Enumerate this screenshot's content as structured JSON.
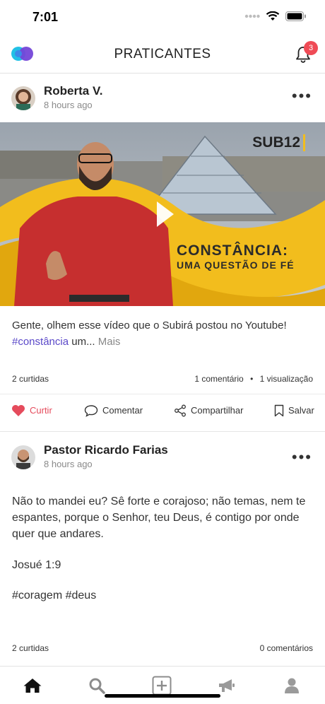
{
  "status": {
    "time": "7:01"
  },
  "header": {
    "title": "PRATICANTES",
    "notification_count": "3"
  },
  "post1": {
    "author": "Roberta V.",
    "time": "8 hours ago",
    "video": {
      "brand": "SUB12",
      "title_line1": "CONSTÂNCIA:",
      "title_line2": "UMA QUESTÃO DE FÉ"
    },
    "caption": "Gente, olhem esse vídeo que o Subirá postou no Youtube!",
    "hashtag": "#constância",
    "caption_rest": " um...",
    "more_label": "Mais",
    "likes": "2 curtidas",
    "comments": "1 comentário",
    "views": "1 visualização",
    "actions": {
      "like": "Curtir",
      "comment": "Comentar",
      "share": "Compartilhar",
      "save": "Salvar"
    }
  },
  "post2": {
    "author": "Pastor Ricardo Farias",
    "time": "8 hours ago",
    "text": "Não to mandei eu? Sê forte e corajoso; não temas, nem te espantes, porque o Senhor, teu Deus, é contigo por onde quer que andares.",
    "reference": "Josué 1:9",
    "hashtags": "#coragem #deus",
    "likes": "2 curtidas",
    "comments": "0 comentários"
  },
  "colors": {
    "accent": "#5b49c9",
    "like": "#e54b5c",
    "badge": "#ef4b56",
    "video_banner": "#f2bd1d"
  },
  "icons": [
    "wifi-icon",
    "battery-icon",
    "bell-icon",
    "more-icon",
    "play-icon",
    "heart-icon",
    "comment-icon",
    "share-icon",
    "bookmark-icon",
    "home-icon",
    "search-icon",
    "add-icon",
    "megaphone-icon",
    "profile-icon"
  ]
}
